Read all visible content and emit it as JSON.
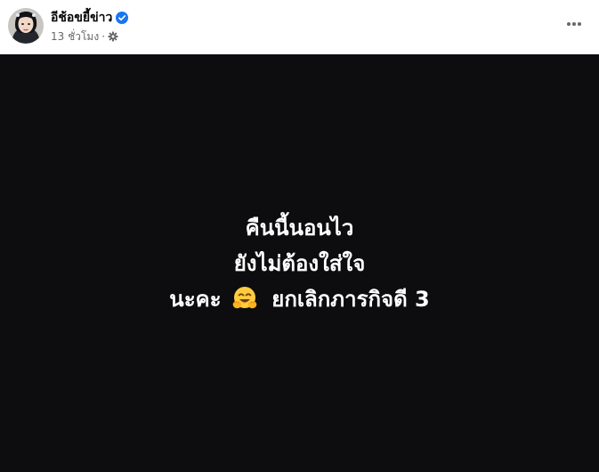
{
  "post": {
    "author": "อีช้อขยี้ข่าว",
    "verified_icon": "verified-badge-icon",
    "timestamp": "13 ชั่วโมง",
    "separator": "·",
    "audience_icon": "gear-icon",
    "more_icon": "more-horizontal-icon"
  },
  "card": {
    "background_color": "#0d0d0f",
    "text_color": "#ffffff",
    "line1": "คืนนี้นอนไว",
    "line2": "ยังไม่ต้องใส่ใจ",
    "line3_before_emoji": "นะคะ",
    "line3_emoji": "hugging-face-emoji",
    "line3_after_emoji": "ยกเลิกภารกิจดี 3"
  },
  "colors": {
    "verified_blue": "#1877f2",
    "secondary_text": "#65676b"
  }
}
